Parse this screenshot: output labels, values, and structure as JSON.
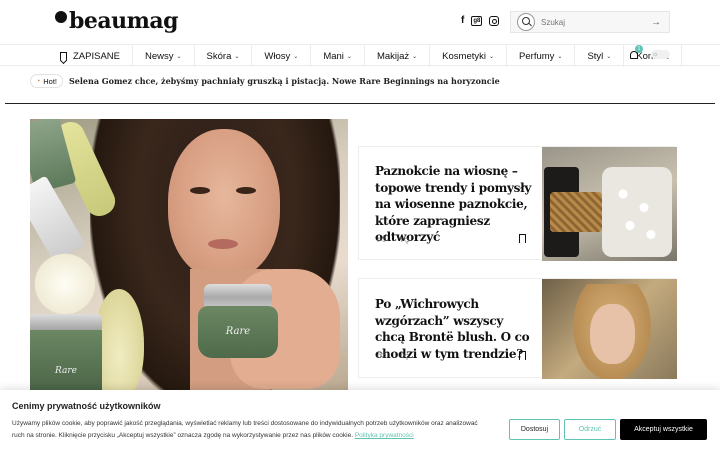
{
  "header": {
    "logo": "beaumag",
    "socials": [
      "facebook-icon",
      "goodreads-icon",
      "instagram-icon"
    ],
    "search": {
      "placeholder": "Szukaj"
    }
  },
  "nav": {
    "saved": "ZAPISANE",
    "items": [
      "Newsy",
      "Skóra",
      "Włosy",
      "Mani",
      "Makijaż",
      "Kosmetyki",
      "Perfumy",
      "Styl",
      "Kontakt"
    ],
    "notification_count": "1"
  },
  "hot": {
    "label": "Hot!",
    "headline": "Selena Gomez chce, żebyśmy pachniały gruszką i pistacją. Nowe Rare Beginnings na horyzoncie"
  },
  "hero": {
    "product_text": "Rare"
  },
  "articles": [
    {
      "title": "Paznokcie na wiosnę – topowe trendy i pomysły na wiosenne paznokcie, które zapragniesz odtworzyć"
    },
    {
      "title": "Po „Wichrowych wzgórzach” wszyscy chcą Brontë blush. O co chodzi w tym trendzie?"
    }
  ],
  "cookie": {
    "title": "Cenimy prywatność użytkowników",
    "text": "Używamy plików cookie, aby poprawić jakość przeglądania, wyświetlać reklamy lub treści dostosowane do indywidualnych potrzeb użytkowników oraz analizować ruch na stronie. Kliknięcie przycisku „Akceptuj wszystkie” oznacza zgodę na wykorzystywanie przez nas plików cookie.",
    "link": "Polityka prywatności",
    "customize": "Dostosuj",
    "reject": "Odrzuć",
    "accept": "Akceptuj wszystkie"
  },
  "colors": {
    "accent": "#5fc4b4",
    "text": "#111111"
  }
}
